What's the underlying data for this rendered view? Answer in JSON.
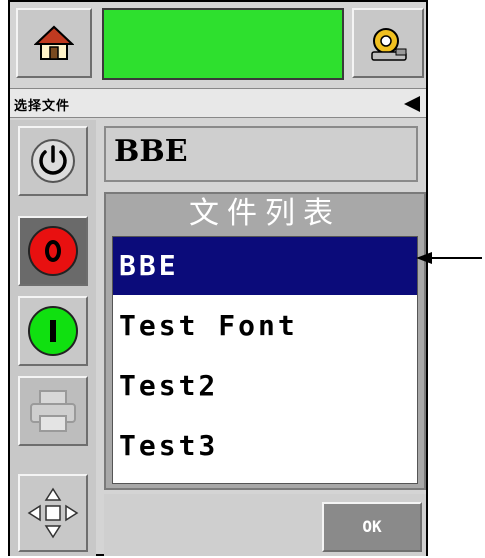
{
  "header": {
    "home_icon": "home-icon",
    "settings_icon": "gear-settings-icon",
    "status_color": "#2ee02e"
  },
  "title_strip": {
    "label": "选择文件",
    "back_icon": "back-arrow-icon"
  },
  "sidebar": {
    "buttons": [
      {
        "name": "power-button",
        "icon": "power-icon"
      },
      {
        "name": "stop-button",
        "icon": "stop-circle-icon",
        "glyph": "O"
      },
      {
        "name": "start-button",
        "icon": "start-circle-icon",
        "glyph": "I"
      },
      {
        "name": "print-button",
        "icon": "printer-icon"
      },
      {
        "name": "navigation-button",
        "icon": "directional-pad-icon"
      }
    ]
  },
  "selected_file": "BBE",
  "file_list": {
    "header": "文件列表",
    "items": [
      "BBE",
      "Test Font",
      "Test2",
      "Test3"
    ],
    "selected_index": 0
  },
  "footer": {
    "ok_label": "OK"
  },
  "colors": {
    "selection": "#0b0b7a",
    "stop": "#e81010",
    "start": "#10e010"
  }
}
